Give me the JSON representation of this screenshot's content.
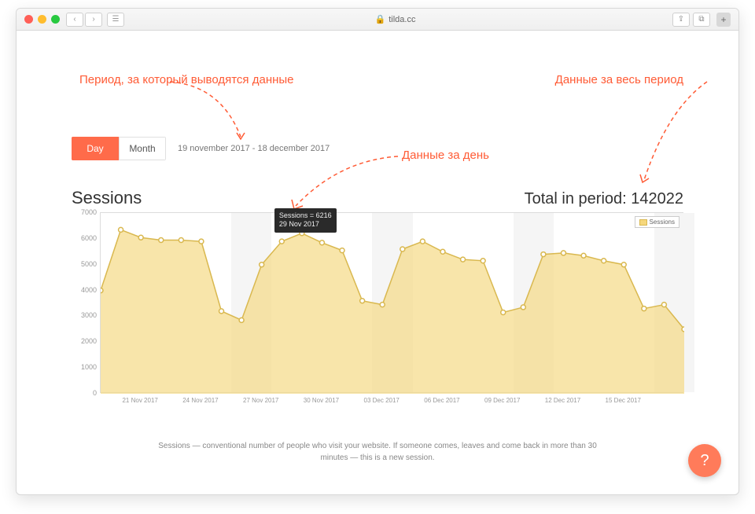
{
  "browser": {
    "url": "tilda.cc"
  },
  "annotations": {
    "period_label": "Период, за который выводятся данные",
    "all_period": "Данные за весь период",
    "day_data": "Данные за день"
  },
  "toggle": {
    "day": "Day",
    "month": "Month"
  },
  "date_range": "19 november 2017 - 18 december 2017",
  "stats": {
    "title": "Sessions",
    "total_label": "Total in period: 142022"
  },
  "tooltip": {
    "line1": "Sessions = 6216",
    "line2": "29 Nov 2017"
  },
  "legend": "Sessions",
  "description": "Sessions — conventional number of people who visit your website. If someone comes, leaves and come back in more than 30 minutes — this is a new session.",
  "help": "?",
  "chart_data": {
    "type": "area",
    "title": "Sessions",
    "ylabel": "",
    "xlabel": "",
    "ylim": [
      0,
      7000
    ],
    "yticks": [
      0,
      1000,
      2000,
      3000,
      4000,
      5000,
      6000,
      7000
    ],
    "x_tick_labels": [
      "21 Nov 2017",
      "24 Nov 2017",
      "27 Nov 2017",
      "30 Nov 2017",
      "03 Dec 2017",
      "06 Dec 2017",
      "09 Dec 2017",
      "12 Dec 2017",
      "15 Dec 2017"
    ],
    "x_tick_indices": [
      2,
      5,
      8,
      11,
      14,
      17,
      20,
      23,
      26
    ],
    "series": [
      {
        "name": "Sessions",
        "x": [
          "19 Nov 2017",
          "20 Nov 2017",
          "21 Nov 2017",
          "22 Nov 2017",
          "23 Nov 2017",
          "24 Nov 2017",
          "25 Nov 2017",
          "26 Nov 2017",
          "27 Nov 2017",
          "28 Nov 2017",
          "29 Nov 2017",
          "30 Nov 2017",
          "01 Dec 2017",
          "02 Dec 2017",
          "03 Dec 2017",
          "04 Dec 2017",
          "05 Dec 2017",
          "06 Dec 2017",
          "07 Dec 2017",
          "08 Dec 2017",
          "09 Dec 2017",
          "10 Dec 2017",
          "11 Dec 2017",
          "12 Dec 2017",
          "13 Dec 2017",
          "14 Dec 2017",
          "15 Dec 2017",
          "16 Dec 2017",
          "17 Dec 2017",
          "18 Dec 2017"
        ],
        "values": [
          4000,
          6350,
          6050,
          5950,
          5950,
          5900,
          3200,
          2850,
          5000,
          5900,
          6216,
          5850,
          5550,
          3600,
          3450,
          5600,
          5900,
          5500,
          5200,
          5150,
          3150,
          3350,
          5400,
          5450,
          5350,
          5150,
          5000,
          3300,
          3450,
          2500
        ]
      }
    ]
  }
}
